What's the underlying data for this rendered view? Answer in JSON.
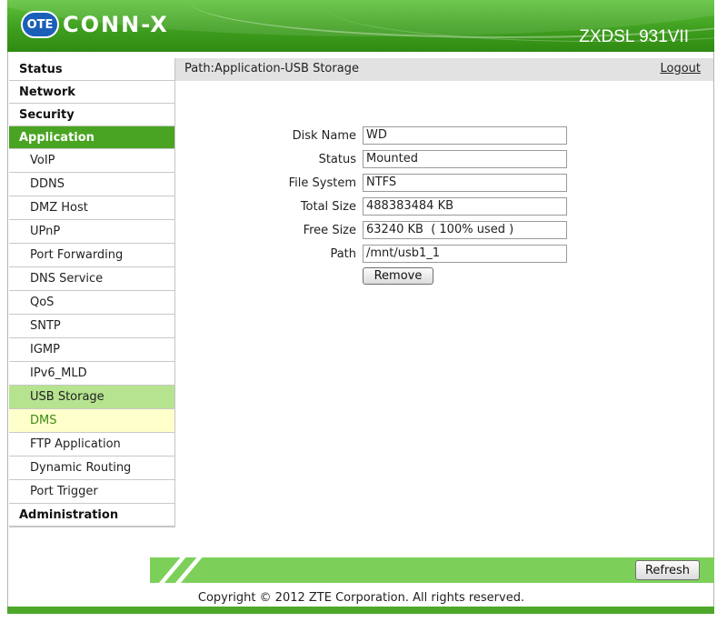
{
  "header": {
    "logo_badge": "OTE",
    "logo_text": "CONN-X",
    "model": "ZXDSL 931VII"
  },
  "sidebar": {
    "items": [
      {
        "label": "Status",
        "level": "top"
      },
      {
        "label": "Network",
        "level": "top"
      },
      {
        "label": "Security",
        "level": "top"
      },
      {
        "label": "Application",
        "level": "top",
        "state": "active"
      },
      {
        "label": "VoIP",
        "level": "sub"
      },
      {
        "label": "DDNS",
        "level": "sub"
      },
      {
        "label": "DMZ Host",
        "level": "sub"
      },
      {
        "label": "UPnP",
        "level": "sub"
      },
      {
        "label": "Port Forwarding",
        "level": "sub"
      },
      {
        "label": "DNS Service",
        "level": "sub"
      },
      {
        "label": "QoS",
        "level": "sub"
      },
      {
        "label": "SNTP",
        "level": "sub"
      },
      {
        "label": "IGMP",
        "level": "sub"
      },
      {
        "label": "IPv6_MLD",
        "level": "sub"
      },
      {
        "label": "USB Storage",
        "level": "sub",
        "state": "current"
      },
      {
        "label": "DMS",
        "level": "sub",
        "state": "hover"
      },
      {
        "label": "FTP Application",
        "level": "sub"
      },
      {
        "label": "Dynamic Routing",
        "level": "sub"
      },
      {
        "label": "Port Trigger",
        "level": "sub"
      },
      {
        "label": "Administration",
        "level": "top"
      }
    ]
  },
  "pathbar": {
    "path": "Path:Application-USB Storage",
    "logout": "Logout"
  },
  "form": {
    "fields": [
      {
        "label": "Disk Name",
        "value": "WD"
      },
      {
        "label": "Status",
        "value": "Mounted"
      },
      {
        "label": "File System",
        "value": "NTFS"
      },
      {
        "label": "Total Size",
        "value": "488383484 KB"
      },
      {
        "label": "Free Size",
        "value": "63240 KB  ( 100% used )"
      },
      {
        "label": "Path",
        "value": "/mnt/usb1_1"
      }
    ],
    "remove_label": "Remove"
  },
  "footer": {
    "refresh_label": "Refresh",
    "copyright": "Copyright © 2012 ZTE Corporation. All rights reserved."
  },
  "colors": {
    "brand_green": "#4aa423",
    "current_item": "#b6e38f",
    "hover_item": "#ffffcc",
    "footer_bar": "#7cd05a"
  }
}
